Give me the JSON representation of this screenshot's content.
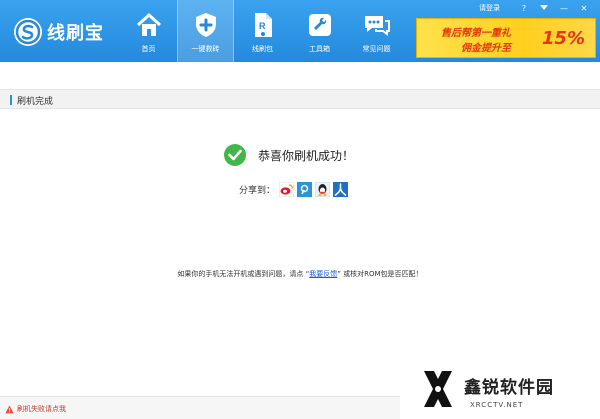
{
  "app": {
    "name": "线刷宝"
  },
  "header": {
    "login": "请登录",
    "help": "?",
    "minimize": "—",
    "close": "✕"
  },
  "nav": {
    "items": [
      {
        "label": "首页",
        "icon": "home-icon"
      },
      {
        "label": "一键救砖",
        "icon": "shield-plus-icon",
        "active": true
      },
      {
        "label": "线刷包",
        "icon": "rom-package-icon"
      },
      {
        "label": "工具箱",
        "icon": "wrench-icon"
      },
      {
        "label": "常见问题",
        "icon": "chat-bubbles-icon"
      }
    ]
  },
  "promo": {
    "line1": "售后帮第一重礼",
    "line2": "佣金提升至",
    "percent": "15%"
  },
  "section": {
    "title": "刷机完成"
  },
  "result": {
    "message": "恭喜你刷机成功！",
    "share_label": "分享到：",
    "share_icons": [
      "weibo-icon",
      "tencent-weibo-icon",
      "qq-icon",
      "renren-icon"
    ]
  },
  "help": {
    "before": "如果你的手机无法开机或遇到问题，请点 “",
    "link": "我要反馈",
    "after": "” 或核对ROM包是否匹配！"
  },
  "footer": {
    "link": "刷机失败请点我"
  },
  "watermark": {
    "title": "鑫锐软件园",
    "subtitle": "XRCCTV.NET"
  },
  "colors": {
    "header_blue": "#2489dc",
    "success_green": "#43b649",
    "link_blue": "#1a5bd6",
    "promo_yellow": "#ffd84a",
    "promo_red": "#e4380c"
  }
}
